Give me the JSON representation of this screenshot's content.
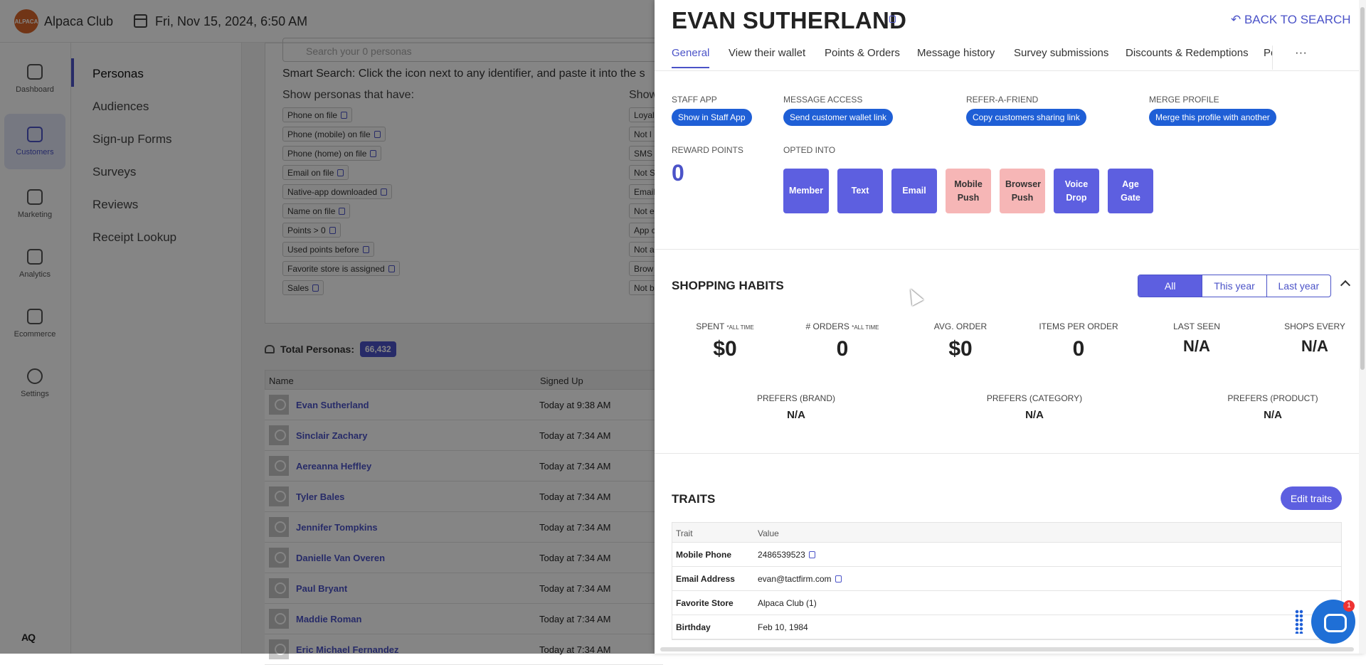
{
  "app": {
    "name": "Alpaca Club",
    "logo_text": "ALPACA",
    "datetime": "Fri, Nov 15, 2024, 6:50 AM",
    "footer_logo": "AQ"
  },
  "rail": [
    {
      "label": "Dashboard",
      "icon": "home-icon"
    },
    {
      "label": "Customers",
      "icon": "customers-icon",
      "active": true
    },
    {
      "label": "Marketing",
      "icon": "megaphone-icon"
    },
    {
      "label": "Analytics",
      "icon": "bar-chart-icon"
    },
    {
      "label": "Ecommerce",
      "icon": "store-icon"
    },
    {
      "label": "Settings",
      "icon": "gear-icon"
    }
  ],
  "subnav": [
    "Personas",
    "Audiences",
    "Sign-up Forms",
    "Surveys",
    "Reviews",
    "Receipt Lookup"
  ],
  "personas": {
    "search_placeholder": "Search your 0 personas",
    "smart_search": "Smart Search: Click the  icon next to any identifier, and paste it into the s",
    "show_have": "Show personas that have:",
    "show_other": "Show",
    "chips": [
      "Phone on file",
      "Phone (mobile) on file",
      "Phone (home) on file",
      "Email on file",
      "Native-app downloaded",
      "Name on file",
      "Points > 0",
      "Used points before",
      "Favorite store is assigned",
      "Sales"
    ],
    "chips_right": [
      "Loyal",
      "Not l",
      "SMS",
      "Not S",
      "Email",
      "Not e",
      "App c",
      "Not a",
      "Brow",
      "Not b"
    ],
    "total_label": "Total Personas:",
    "total_count": "66,432",
    "columns": [
      "Name",
      "Signed Up"
    ],
    "rows": [
      {
        "name": "Evan Sutherland",
        "signed": "Today at 9:38 AM"
      },
      {
        "name": "Sinclair Zachary",
        "signed": "Today at 7:34 AM"
      },
      {
        "name": "Aereanna Heffley",
        "signed": "Today at 7:34 AM"
      },
      {
        "name": "Tyler Bales",
        "signed": "Today at 7:34 AM"
      },
      {
        "name": "Jennifer Tompkins",
        "signed": "Today at 7:34 AM"
      },
      {
        "name": "Danielle Van Overen",
        "signed": "Today at 7:34 AM"
      },
      {
        "name": "Paul Bryant",
        "signed": "Today at 7:34 AM"
      },
      {
        "name": "Maddie Roman",
        "signed": "Today at 7:34 AM"
      },
      {
        "name": "Eric Michael Fernandez",
        "signed": "Today at 7:34 AM"
      }
    ]
  },
  "profile": {
    "name": "EVAN SUTHERLAND",
    "back": "BACK TO SEARCH",
    "tabs": [
      "General",
      "View their wallet",
      "Points & Orders",
      "Message history",
      "Survey submissions",
      "Discounts & Redemptions",
      "Pe"
    ],
    "more": "···",
    "actions": [
      {
        "label": "STAFF APP",
        "button": "Show in Staff App"
      },
      {
        "label": "MESSAGE ACCESS",
        "button": "Send customer wallet link"
      },
      {
        "label": "REFER-A-FRIEND",
        "button": "Copy customers sharing link"
      },
      {
        "label": "MERGE PROFILE",
        "button": "Merge this profile with another"
      }
    ],
    "reward_label": "REWARD POINTS",
    "reward_value": "0",
    "opted_label": "OPTED INTO",
    "opted": [
      {
        "label": "Member",
        "on": true
      },
      {
        "label": "Text",
        "on": true
      },
      {
        "label": "Email",
        "on": true
      },
      {
        "label": "Mobile Push",
        "on": false
      },
      {
        "label": "Browser Push",
        "on": false
      },
      {
        "label": "Voice Drop",
        "on": true
      },
      {
        "label": "Age Gate",
        "on": true
      }
    ],
    "habits_title": "SHOPPING HABITS",
    "habits_filters": [
      "All",
      "This year",
      "Last year"
    ],
    "stats": [
      {
        "k": "SPENT",
        "s": "*ALL TIME",
        "v": "$0"
      },
      {
        "k": "# ORDERS",
        "s": "*ALL TIME",
        "v": "0"
      },
      {
        "k": "AVG. ORDER",
        "s": "",
        "v": "$0"
      },
      {
        "k": "ITEMS PER ORDER",
        "s": "",
        "v": "0"
      },
      {
        "k": "LAST SEEN",
        "s": "",
        "v": "N/A"
      },
      {
        "k": "SHOPS EVERY",
        "s": "",
        "v": "N/A"
      }
    ],
    "prefs": [
      {
        "k": "PREFERS (BRAND)",
        "v": "N/A"
      },
      {
        "k": "PREFERS (CATEGORY)",
        "v": "N/A"
      },
      {
        "k": "PREFERS (PRODUCT)",
        "v": "N/A"
      }
    ],
    "traits_title": "TRAITS",
    "edit_traits": "Edit traits",
    "trait_cols": [
      "Trait",
      "Value"
    ],
    "traits": [
      {
        "k": "Mobile Phone",
        "v": "2486539523"
      },
      {
        "k": "Email Address",
        "v": "evan@tactfirm.com"
      },
      {
        "k": "Favorite Store",
        "v": "Alpaca Club (1)"
      },
      {
        "k": "Birthday",
        "v": "Feb 10, 1984"
      }
    ]
  },
  "chat_badge": "1",
  "colors": {
    "accent": "#4b53c8",
    "pill": "#1f5fd6",
    "opt_on": "#5d5fe0",
    "opt_off": "#f6b6b6"
  }
}
